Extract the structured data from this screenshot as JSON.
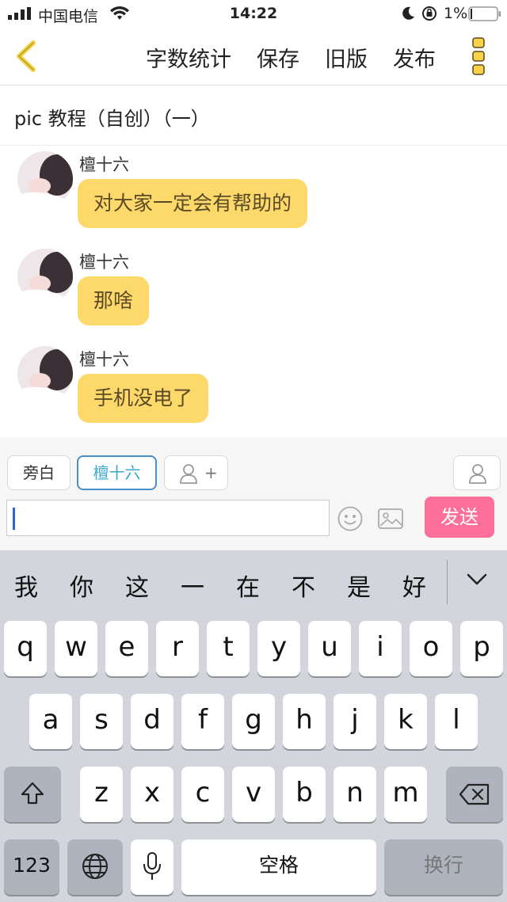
{
  "status_bar": {
    "carrier": "中国电信",
    "time": "14:22",
    "battery": "1%"
  },
  "nav": {
    "word_count": "字数统计",
    "save": "保存",
    "old_version": "旧版",
    "publish": "发布"
  },
  "title": "pic 教程（自创）（一）",
  "messages": [
    {
      "sender": "檀十六",
      "text": "对大家一定会有帮助的"
    },
    {
      "sender": "檀十六",
      "text": "那啥"
    },
    {
      "sender": "檀十六",
      "text": "手机没电了"
    }
  ],
  "composer": {
    "narrator_chip": "旁白",
    "character_chip": "檀十六",
    "add_role_plus": "+",
    "send": "发送",
    "input_value": ""
  },
  "keyboard": {
    "candidates": [
      "我",
      "你",
      "这",
      "一",
      "在",
      "不",
      "是",
      "好"
    ],
    "row1": [
      "q",
      "w",
      "e",
      "r",
      "t",
      "y",
      "u",
      "i",
      "o",
      "p"
    ],
    "row2": [
      "a",
      "s",
      "d",
      "f",
      "g",
      "h",
      "j",
      "k",
      "l"
    ],
    "row3": [
      "z",
      "x",
      "c",
      "v",
      "b",
      "n",
      "m"
    ],
    "numbers": "123",
    "space": "空格",
    "return": "换行"
  },
  "colors": {
    "bubble": "#fdd96c",
    "send": "#ff6f9b",
    "accent_chip": "#3aa9d0",
    "back_arrow": "#f2cf3f"
  }
}
